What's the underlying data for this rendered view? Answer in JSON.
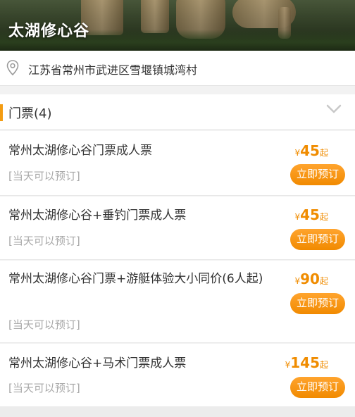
{
  "hero": {
    "title": "太湖修心谷"
  },
  "address": {
    "text": "江苏省常州市武进区雪堰镇城湾村",
    "icon": "location-pin-icon"
  },
  "tickets": {
    "title": "门票(4)",
    "items": [
      {
        "name": "常州太湖修心谷门票成人票",
        "note": "[当天可以预订]",
        "currency": "¥",
        "price": "45",
        "suffix": "起",
        "button": "立即预订"
      },
      {
        "name": "常州太湖修心谷+垂钓门票成人票",
        "note": "[当天可以预订]",
        "currency": "¥",
        "price": "45",
        "suffix": "起",
        "button": "立即预订"
      },
      {
        "name": "常州太湖修心谷门票+游艇体验大小同价(6人起)",
        "note": "[当天可以预订]",
        "currency": "¥",
        "price": "90",
        "suffix": "起",
        "button": "立即预订"
      },
      {
        "name": "常州太湖修心谷+马术门票成人票",
        "note": "[当天可以预订]",
        "currency": "¥",
        "price": "145",
        "suffix": "起",
        "button": "立即预订"
      }
    ]
  },
  "colors": {
    "accent": "#f08c00",
    "button": "#f39c12",
    "text": "#333333",
    "muted": "#a8a8a8"
  }
}
